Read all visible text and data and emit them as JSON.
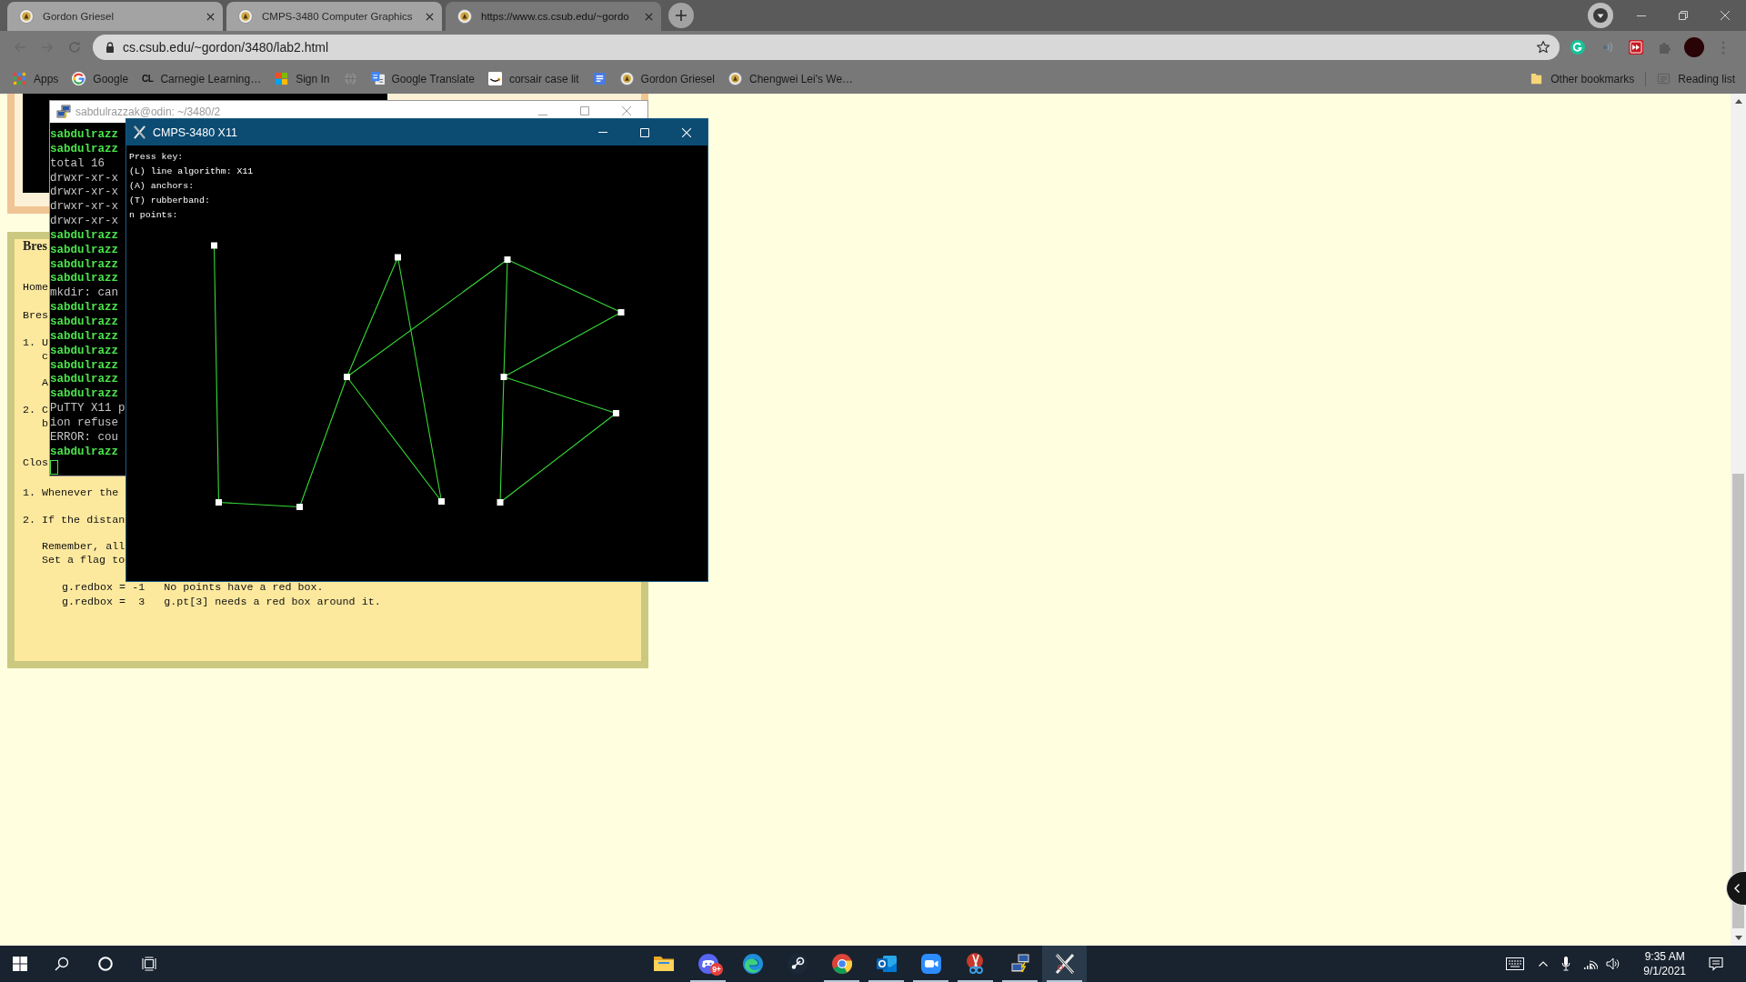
{
  "browser": {
    "tabs": [
      {
        "title": "Gordon Griesel",
        "selected": false
      },
      {
        "title": "CMPS-3480 Computer Graphics",
        "selected": false
      },
      {
        "title": "https://www.cs.csub.edu/~gordo",
        "selected": true
      }
    ],
    "address": "cs.csub.edu/~gordon/3480/lab2.html",
    "bookmarks": [
      {
        "kind": "grid",
        "label": "Apps"
      },
      {
        "kind": "g",
        "label": "Google"
      },
      {
        "kind": "monogram",
        "icon_text": "CL",
        "label": "Carnegie Learning…"
      },
      {
        "kind": "squares",
        "label": "Sign In"
      },
      {
        "kind": "globe"
      },
      {
        "kind": "translate",
        "label": "Google Translate"
      },
      {
        "kind": "smile",
        "label": "corsair case lit"
      },
      {
        "kind": "doc"
      },
      {
        "kind": "crest",
        "label": "Gordon Griesel"
      },
      {
        "kind": "crest",
        "label": "Chengwei Lei's We…"
      }
    ],
    "other_bookmarks": "Other bookmarks",
    "reading_list": "Reading list"
  },
  "page": {
    "lines": [
      {
        "kind": "title",
        "text": "Bres"
      },
      {
        "kind": "nav",
        "text": "Home"
      },
      {
        "kind": "heading",
        "text": "Bres"
      },
      {
        "kind": "item",
        "text": "1. U"
      },
      {
        "kind": "wrap",
        "text": "c"
      },
      {
        "kind": "note",
        "text": "A"
      },
      {
        "kind": "item",
        "text": "2. C"
      },
      {
        "kind": "wrap",
        "text": "b"
      },
      {
        "kind": "heading",
        "text": "Clos"
      },
      {
        "kind": "item",
        "text": "1. Whenever the"
      },
      {
        "kind": "item",
        "text": "2. If the distan"
      },
      {
        "kind": "note",
        "text": "Remember, all"
      },
      {
        "kind": "wrap",
        "text": "Set a flag to"
      },
      {
        "kind": "code",
        "text": "g.redbox = -1   No points have a red box."
      },
      {
        "kind": "codewrap",
        "text": "g.redbox =  3   g.pt[3] needs a red box around it."
      }
    ]
  },
  "putty_window": {
    "title": "sabdulrazzak@odin: ~/3480/2",
    "lines": [
      {
        "kind": "prompt",
        "text": "sabdulrazz"
      },
      {
        "kind": "prompt",
        "text": "sabdulrazz"
      },
      {
        "kind": "output",
        "text": "total 16"
      },
      {
        "kind": "output",
        "text": "drwxr-xr-x"
      },
      {
        "kind": "output",
        "text": "drwxr-xr-x"
      },
      {
        "kind": "output",
        "text": "drwxr-xr-x"
      },
      {
        "kind": "output",
        "text": "drwxr-xr-x"
      },
      {
        "kind": "prompt",
        "text": "sabdulrazz"
      },
      {
        "kind": "prompt",
        "text": "sabdulrazz"
      },
      {
        "kind": "prompt",
        "text": "sabdulrazz"
      },
      {
        "kind": "prompt",
        "text": "sabdulrazz"
      },
      {
        "kind": "output",
        "text": "mkdir: can"
      },
      {
        "kind": "prompt",
        "text": "sabdulrazz"
      },
      {
        "kind": "prompt",
        "text": "sabdulrazz"
      },
      {
        "kind": "prompt",
        "text": "sabdulrazz"
      },
      {
        "kind": "prompt",
        "text": "sabdulrazz"
      },
      {
        "kind": "prompt",
        "text": "sabdulrazz"
      },
      {
        "kind": "prompt",
        "text": "sabdulrazz"
      },
      {
        "kind": "prompt",
        "text": "sabdulrazz"
      },
      {
        "kind": "output",
        "text": "PuTTY X11 p"
      },
      {
        "kind": "output",
        "text": "ion refuse"
      },
      {
        "kind": "output",
        "text": "ERROR: cou"
      },
      {
        "kind": "prompt",
        "text": "sabdulrazz"
      }
    ]
  },
  "x11_window": {
    "title": "CMPS-3480 X11",
    "lines": [
      "Press key:",
      "(L) line algorithm: X11",
      "(A) anchors:",
      "(T) rubberband:",
      "n points:"
    ]
  },
  "taskbar": {
    "apps": [
      {
        "kind": "folder",
        "running": false,
        "selected": false
      },
      {
        "kind": "chat",
        "running": true,
        "selected": false,
        "badge": "9+"
      },
      {
        "kind": "swirl",
        "running": false,
        "selected": false
      },
      {
        "kind": "steam",
        "running": false,
        "selected": false
      },
      {
        "kind": "chrome",
        "running": true,
        "selected": false
      },
      {
        "kind": "mail",
        "running": true,
        "selected": false
      },
      {
        "kind": "video",
        "running": true,
        "selected": false
      },
      {
        "kind": "scissors",
        "running": true,
        "selected": false
      },
      {
        "kind": "putty",
        "running": true,
        "selected": false
      },
      {
        "kind": "xlogo",
        "running": true,
        "selected": true
      }
    ],
    "time": "9:35 AM",
    "date": "9/1/2021"
  }
}
